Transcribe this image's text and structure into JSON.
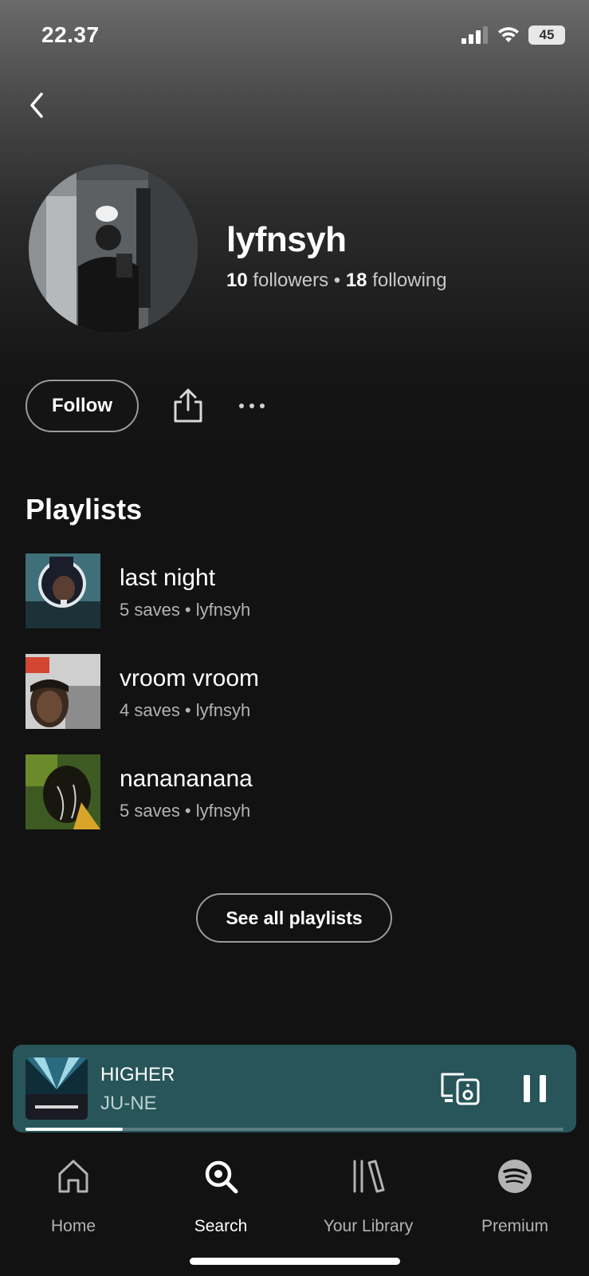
{
  "status_bar": {
    "time": "22.37",
    "battery": "45"
  },
  "profile": {
    "name": "lyfnsyh",
    "followers_count": "10",
    "followers_label": "followers",
    "separator": "•",
    "following_count": "18",
    "following_label": "following"
  },
  "actions": {
    "follow_label": "Follow"
  },
  "playlists": {
    "section_title": "Playlists",
    "items": [
      {
        "title": "last night",
        "meta": "5 saves • lyfnsyh"
      },
      {
        "title": "vroom vroom",
        "meta": "4 saves • lyfnsyh"
      },
      {
        "title": "nanananana",
        "meta": "5 saves • lyfnsyh"
      }
    ],
    "see_all_label": "See all playlists"
  },
  "now_playing": {
    "title": "HIGHER",
    "artist": "JU-NE",
    "progress": 0.18
  },
  "nav": {
    "items": [
      {
        "label": "Home",
        "icon": "home-icon",
        "active": false
      },
      {
        "label": "Search",
        "icon": "search-icon",
        "active": true
      },
      {
        "label": "Your Library",
        "icon": "library-icon",
        "active": false
      },
      {
        "label": "Premium",
        "icon": "spotify-icon",
        "active": false
      }
    ]
  },
  "colors": {
    "background": "#121212",
    "mini_player": "#275559",
    "text_secondary": "#b3b3b3"
  }
}
